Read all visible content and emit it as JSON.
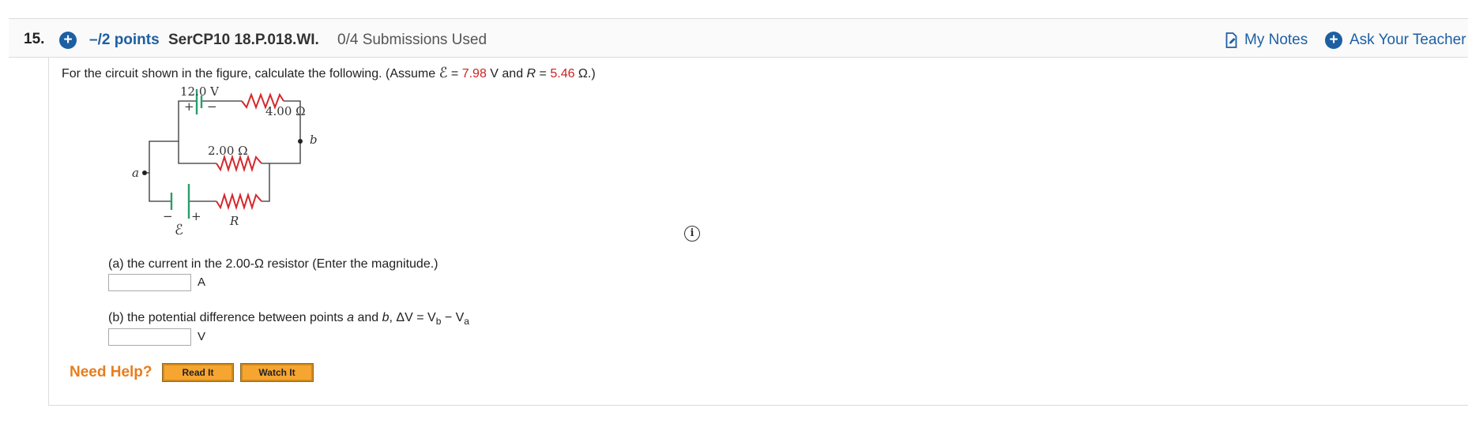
{
  "header": {
    "question_number": "15.",
    "points": "–/2 points",
    "question_code": "SerCP10 18.P.018.WI.",
    "submissions": "0/4 Submissions Used",
    "my_notes": "My Notes",
    "ask_teacher": "Ask Your Teacher"
  },
  "question": {
    "prompt_pre": "For the circuit shown in the figure, calculate the following. (Assume ",
    "emf_symbol": "ℰ",
    "eq": " = ",
    "emf_value": "7.98",
    "mid": " V and ",
    "r_symbol": "R",
    "r_value": "5.46",
    "post": " Ω.)",
    "parts": [
      {
        "label": "(a) the current in the 2.00-Ω resistor (Enter the magnitude.)",
        "unit": "A",
        "value": ""
      },
      {
        "label_pre": "(b) the potential difference between points ",
        "a": "a",
        "and": " and ",
        "b": "b",
        "dv": ", ΔV = V",
        "sub_b": "b",
        "minus": " − V",
        "sub_a": "a",
        "unit": "V",
        "value": ""
      }
    ]
  },
  "figure": {
    "battery_top_label": "12.0 V",
    "plus": "+",
    "minus": "−",
    "r_top": "4.00 Ω",
    "r_mid": "2.00 Ω",
    "point_a": "a",
    "point_b": "b",
    "r_bottom": "R",
    "emf": "ℰ",
    "wire_color": "#333333",
    "battery_color": "#2a9d6a",
    "resistor_color": "#d6282b"
  },
  "help": {
    "need_help": "Need Help?",
    "read_it": "Read It",
    "watch_it": "Watch It"
  },
  "info_icon_glyph": "i"
}
